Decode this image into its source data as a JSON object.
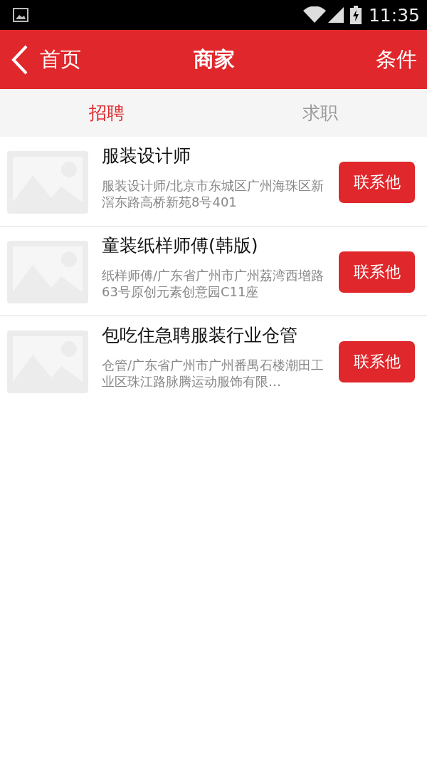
{
  "status_bar": {
    "time": "11:35"
  },
  "header": {
    "back_label": "首页",
    "title": "商家",
    "action": "条件"
  },
  "tabs": [
    {
      "label": "招聘",
      "selected": true
    },
    {
      "label": "求职",
      "selected": false
    }
  ],
  "listings": [
    {
      "title": "服装设计师",
      "description": "服装设计师/北京市东城区广州海珠区新滘东路高桥新苑8号401",
      "button": "联系他"
    },
    {
      "title": "童装纸样师傅(韩版)",
      "description": "纸样师傅/广东省广州市广州荔湾西增路63号原创元素创意园C11座",
      "button": "联系他"
    },
    {
      "title": "包吃住急聘服装行业仓管",
      "description": "仓管/广东省广州市广州番禺石楼潮田工业区珠江路脉腾运动服饰有限…",
      "button": "联系他"
    }
  ]
}
